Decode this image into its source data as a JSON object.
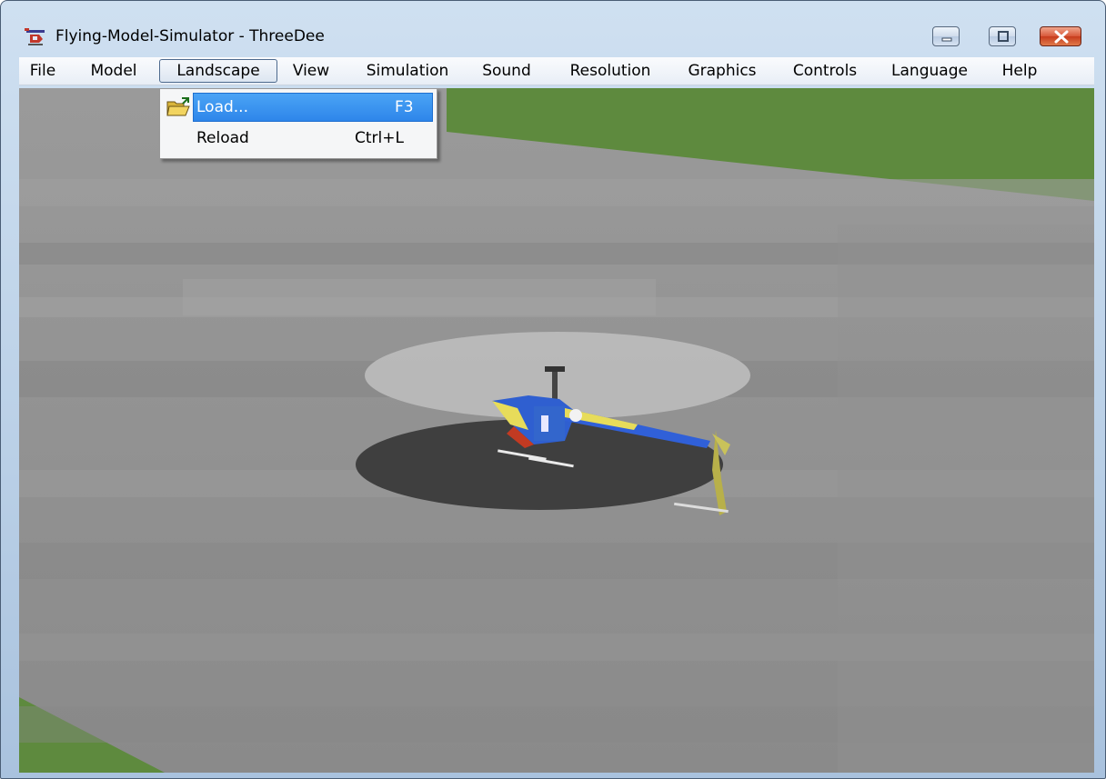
{
  "window": {
    "title": "Flying-Model-Simulator - ThreeDee",
    "icon": "helicopter-app-icon",
    "controls": [
      "minimize-icon",
      "maximize-icon",
      "close-icon"
    ]
  },
  "menubar": {
    "items": [
      {
        "label": "File"
      },
      {
        "label": "Model"
      },
      {
        "label": "Landscape",
        "open": true
      },
      {
        "label": "View"
      },
      {
        "label": "Simulation"
      },
      {
        "label": "Sound"
      },
      {
        "label": "Resolution"
      },
      {
        "label": "Graphics"
      },
      {
        "label": "Controls"
      },
      {
        "label": "Language"
      },
      {
        "label": "Help"
      }
    ]
  },
  "landscape_menu": {
    "items": [
      {
        "label": "Load...",
        "shortcut": "F3",
        "icon": "folder-open-icon",
        "highlighted": true
      },
      {
        "label": "Reload",
        "shortcut": "Ctrl+L",
        "highlighted": false
      }
    ]
  },
  "scene": {
    "description_icon": "helicopter-model",
    "colors": {
      "ground": "#8e8e8e",
      "grass": "#5e8a3e",
      "shadow": "#3f3f3f",
      "rotor_disc": "#b9b9b9",
      "highlight": "#2e86ea"
    }
  }
}
